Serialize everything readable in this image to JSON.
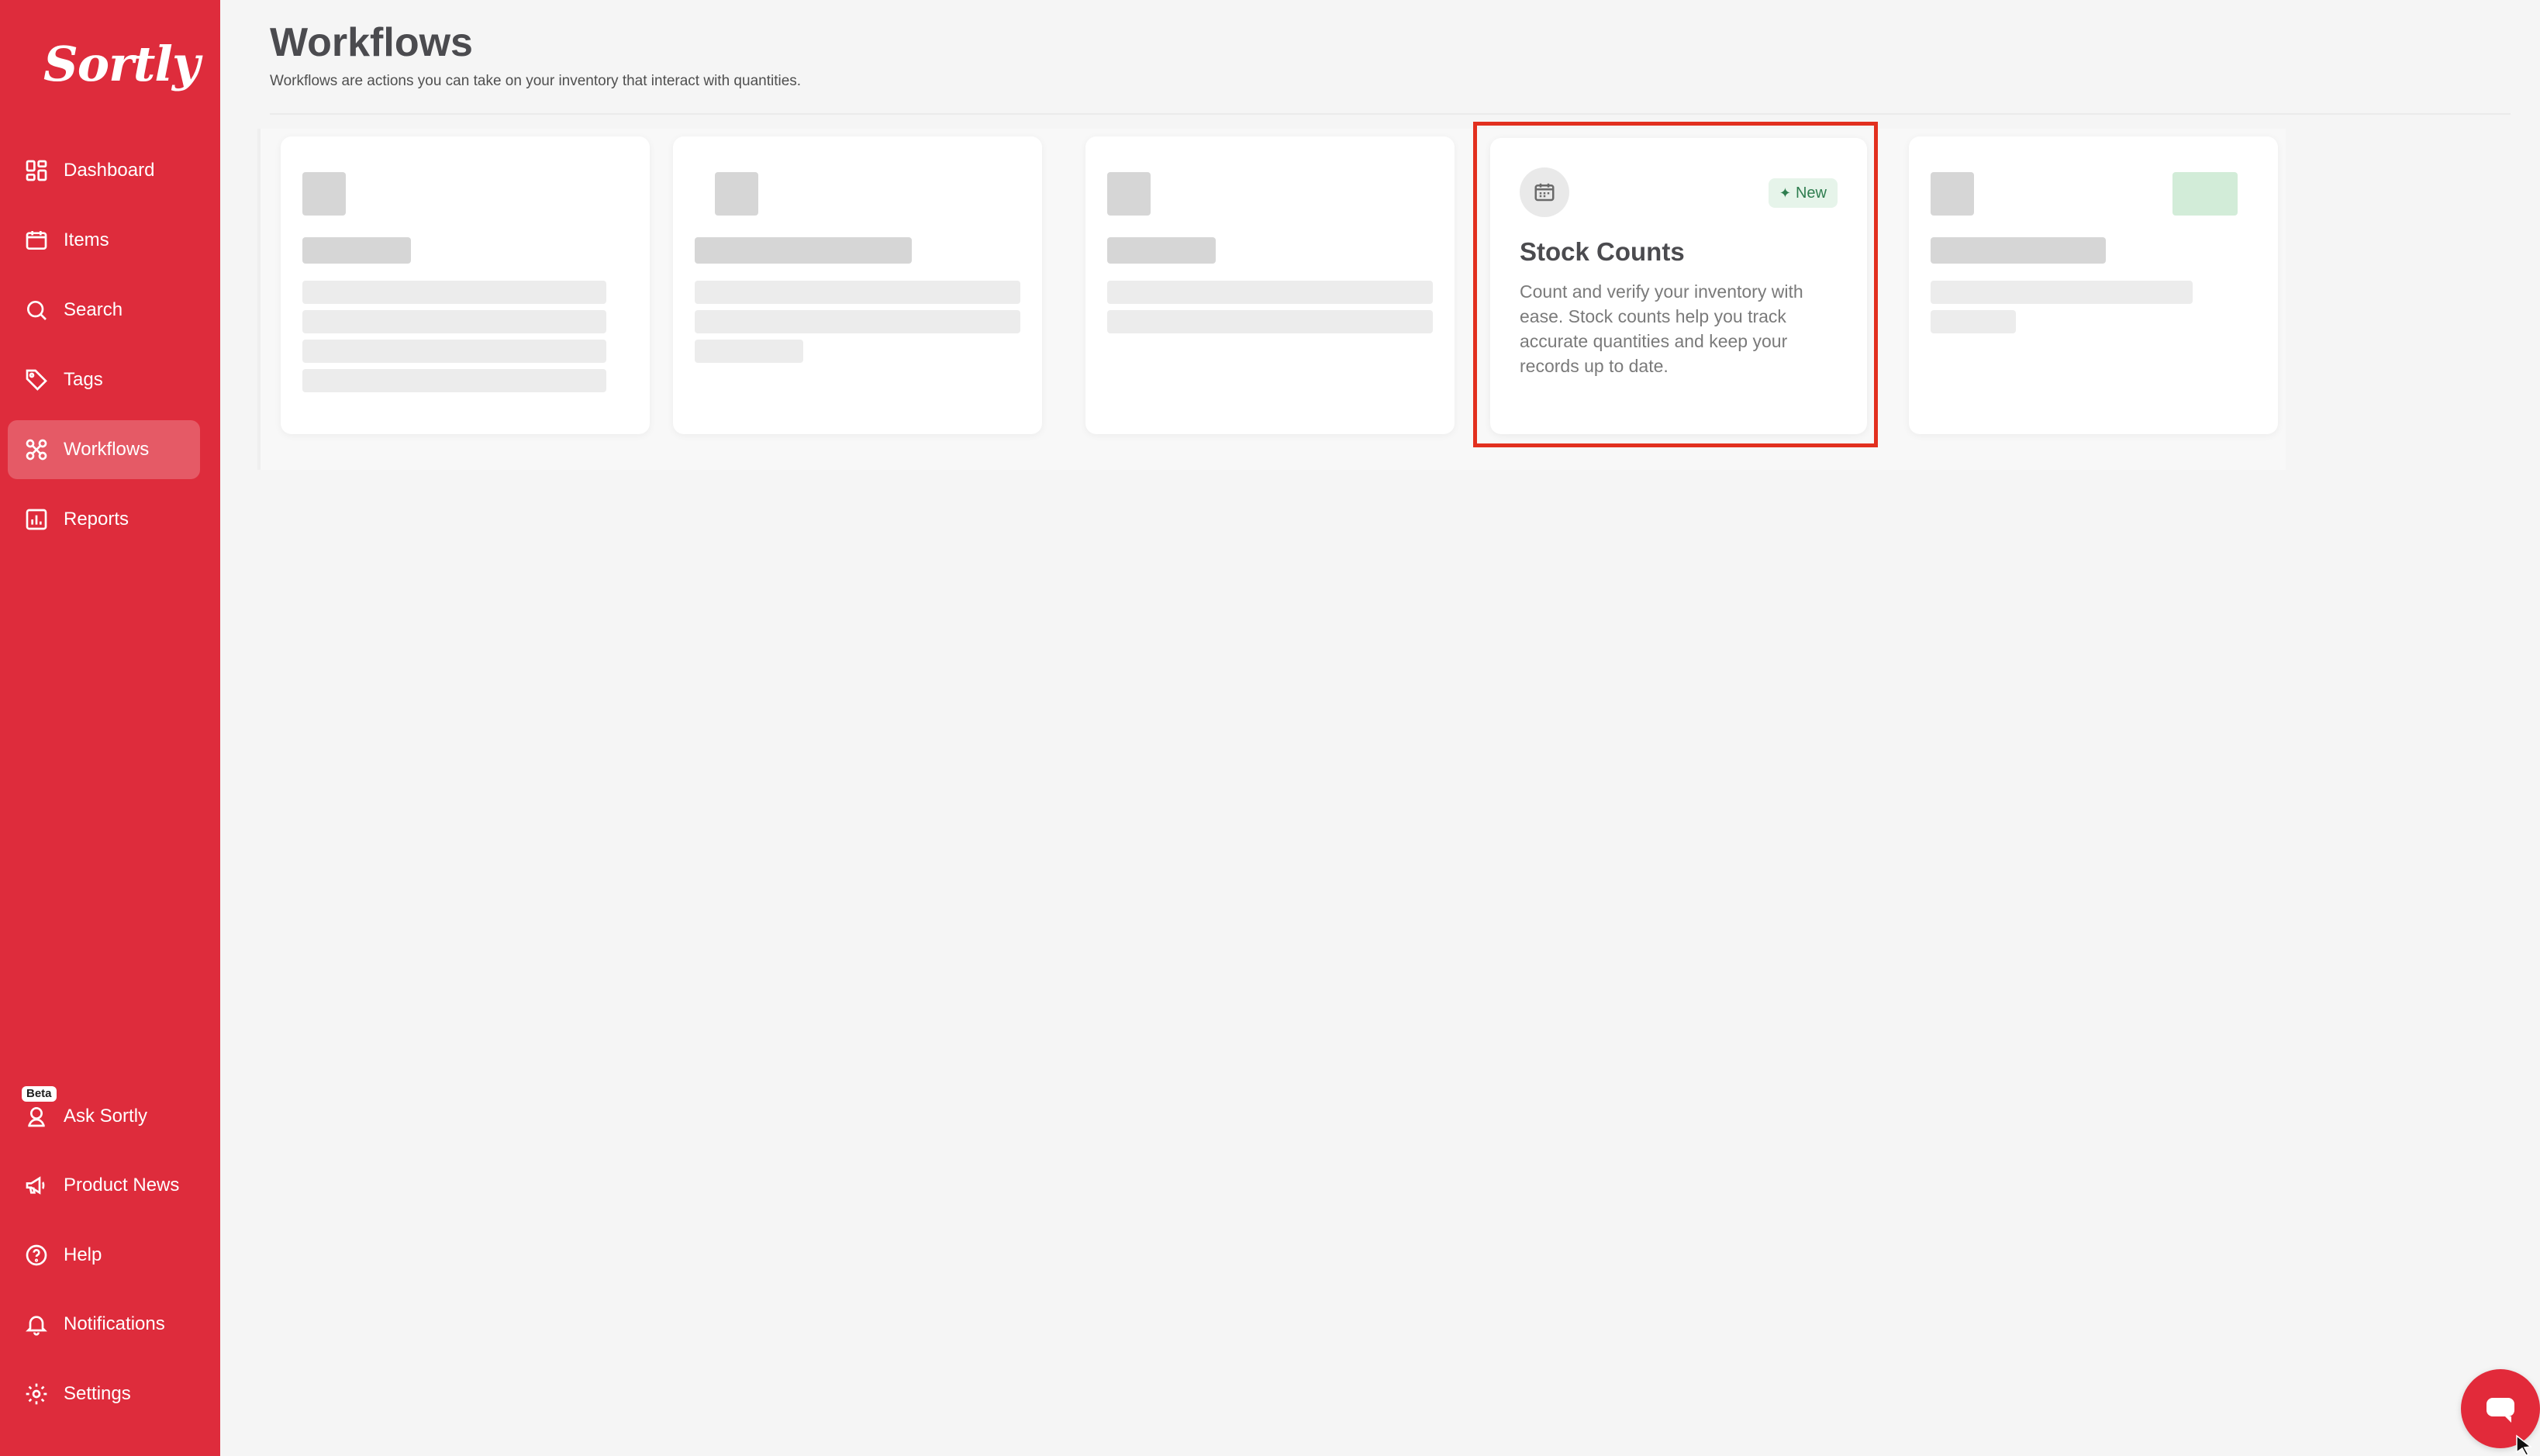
{
  "app": {
    "logo_text": "Sortly"
  },
  "sidebar": {
    "items": [
      {
        "label": "Dashboard",
        "icon": "dashboard-icon"
      },
      {
        "label": "Items",
        "icon": "items-icon"
      },
      {
        "label": "Search",
        "icon": "search-icon"
      },
      {
        "label": "Tags",
        "icon": "tag-icon"
      },
      {
        "label": "Workflows",
        "icon": "workflows-icon",
        "active": true
      },
      {
        "label": "Reports",
        "icon": "reports-icon"
      }
    ],
    "bottom_items": [
      {
        "label": "Ask Sortly",
        "icon": "ask-sortly-icon",
        "badge": "Beta"
      },
      {
        "label": "Product News",
        "icon": "megaphone-icon"
      },
      {
        "label": "Help",
        "icon": "help-icon"
      },
      {
        "label": "Notifications",
        "icon": "bell-icon"
      },
      {
        "label": "Settings",
        "icon": "gear-icon"
      }
    ]
  },
  "header": {
    "title": "Workflows",
    "subtitle": "Workflows are actions you can take on your inventory that interact with quantities."
  },
  "workflow_cards": {
    "featured": {
      "title": "Stock Counts",
      "badge": "New",
      "description": "Count and verify your inventory with ease. Stock counts help you track accurate quantities and keep your records up to date.",
      "icon": "calendar-count-icon"
    }
  },
  "colors": {
    "sidebar_bg": "#de2c3c",
    "highlight_border": "#e2301f",
    "badge_bg": "#e6f4ea",
    "badge_text": "#2e7d4f"
  }
}
